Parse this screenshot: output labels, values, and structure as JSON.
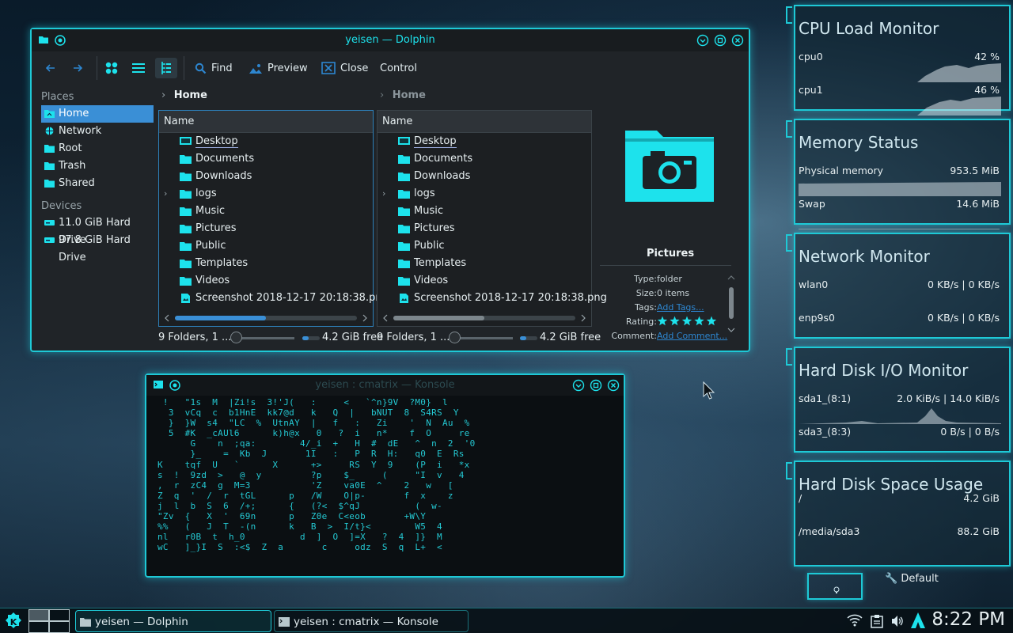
{
  "dolphin": {
    "title": "yeisen — Dolphin",
    "toolbar": {
      "find": "Find",
      "preview": "Preview",
      "close": "Close",
      "control": "Control"
    },
    "places_header": "Places",
    "places": [
      "Home",
      "Network",
      "Root",
      "Trash",
      "Shared"
    ],
    "devices_header": "Devices",
    "devices": [
      "11.0 GiB Hard Drive",
      "97.8 GiB Hard Drive"
    ],
    "left_crumb": "Home",
    "right_crumb": "Home",
    "column_name": "Name",
    "files": [
      "Desktop",
      "Documents",
      "Downloads",
      "logs",
      "Music",
      "Pictures",
      "Public",
      "Templates",
      "Videos",
      "Screenshot 2018-12-17 20:18:38.png"
    ],
    "status_left": "9 Folders, 1 ...",
    "status_left_free": "4.2 GiB free",
    "status_right": "9 Folders, 1 ...",
    "status_right_free": "4.2 GiB free",
    "info": {
      "name": "Pictures",
      "type_label": "Type:",
      "type_value": "folder",
      "size_label": "Size:",
      "size_value": "0 items",
      "tags_label": "Tags:",
      "tags_value": "Add Tags...",
      "rating_label": "Rating:",
      "rating_value": 5,
      "comment_label": "Comment:",
      "comment_value": "Add Comment..."
    }
  },
  "konsole": {
    "title": "yeisen : cmatrix — Konsole",
    "matrix_lines": [
      " !   \"1s  M  |Zi!s  3!'J(   :     <   `^n}9V  ?M0}  l",
      "  3  vCq  c  b1HnE  kk7@d   k   Q  |   bNUT  8  S4RS  Y",
      "  }  }W  s4  \"LC  %  UtnAY  |   f   :   Zi    '  N  Au  %",
      "  5  #K  _cAUl6      k)h@x   0   ?  i   n*    f  O     re",
      "      G    n  ;qa:        4/_i  +   H  #  dE   ^  n  2  '0",
      "      }_    =  Kb  J       1I   :   P  R  H:   q0  E  Rs",
      "K    tqf  U   `      X      +>     RS  Y  9    (P  i   *x",
      "s  !  9zd  >   @  y         ?p    $_     (     \"I  v   4",
      ",  r  zC4  g  M=3           'Z    va0E  ^    2   w   [",
      "Z  q  '  /  r  tGL      p   /W    O|p-       f  x    z",
      "j  l  b  S  6  /+;      {   (?<  $^qJ          (  w-",
      "\"Zv  {   X  '  69n      p   Z0e  C<eob       +W\\Y",
      "%%   (   J  T  -(n      k   B  >  I/t}<        W5  4",
      "nl   r0B  t  h_0          d  ]  O  ]=X   ?  4  ]}  M",
      "wC   ]_}I  S  :<$  Z  a       c     odz  S  q  L+  <"
    ]
  },
  "widgets": {
    "cpu": {
      "title": "CPU Load Monitor",
      "rows": [
        {
          "label": "cpu0",
          "value": "42 %"
        },
        {
          "label": "cpu1",
          "value": "46 %"
        }
      ]
    },
    "memory": {
      "title": "Memory Status",
      "rows": [
        {
          "label": "Physical memory",
          "value": "953.5 MiB"
        },
        {
          "label": "Swap",
          "value": "14.6 MiB"
        }
      ]
    },
    "network": {
      "title": "Network Monitor",
      "rows": [
        {
          "label": "wlan0",
          "value": "0 KB/s | 0 KB/s"
        },
        {
          "label": "enp9s0",
          "value": "0 KB/s | 0 KB/s"
        }
      ]
    },
    "disk_io": {
      "title": "Hard Disk I/O Monitor",
      "rows": [
        {
          "label": "sda1_(8:1)",
          "value": "2.0 KiB/s | 14.0 KiB/s"
        },
        {
          "label": "sda3_(8:3)",
          "value": "0 B/s | 0 B/s"
        }
      ]
    },
    "disk_space": {
      "title": "Hard Disk Space Usage",
      "rows": [
        {
          "label": "/",
          "value": "4.2 GiB"
        },
        {
          "label": "/media/sda3",
          "value": "88.2 GiB"
        }
      ]
    },
    "activity": "Default"
  },
  "taskbar": {
    "tasks": [
      "yeisen — Dolphin",
      "yeisen : cmatrix — Konsole"
    ],
    "clock": "8:22 PM"
  },
  "colors": {
    "accent": "#1de2ec",
    "selection": "#3a8fd6",
    "window_bg": "#202428"
  }
}
